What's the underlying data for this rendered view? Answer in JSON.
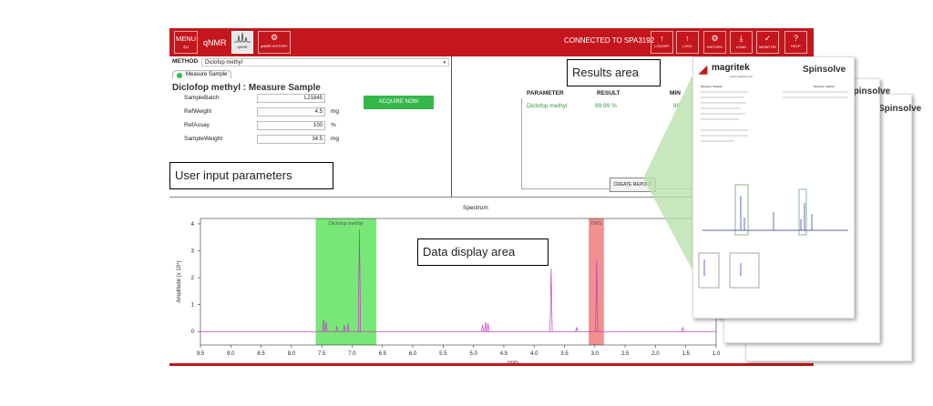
{
  "toolbar": {
    "menu_label": "MENU",
    "qnmr_label": "qNMR",
    "peaks_label": "qNMR",
    "history_label": "qNMR HISTORY",
    "connected_text": "CONNECTED TO SPA3192",
    "buttons": [
      {
        "icon": "up-arrow-icon",
        "glyph": "↑",
        "label": "LOGOFF"
      },
      {
        "icon": "up-arrow-icon",
        "glyph": "↑",
        "label": "LOCK"
      },
      {
        "icon": "gears-icon",
        "glyph": "⚙",
        "label": "HISTORY"
      },
      {
        "icon": "download-icon",
        "glyph": "⤓",
        "label": "LOAD"
      },
      {
        "icon": "checkmark-icon",
        "glyph": "✓",
        "label": "MONITOR"
      },
      {
        "icon": "question-icon",
        "glyph": "?",
        "label": "HELP"
      }
    ]
  },
  "method": {
    "label": "METHOD",
    "value": "Diclofop methyl"
  },
  "tab": {
    "label": "Measure Sample"
  },
  "form": {
    "title": "Diclofop methyl : Measure Sample",
    "fields": [
      {
        "label": "SampleBatch",
        "value": "L21845",
        "unit": ""
      },
      {
        "label": "RefWeight",
        "value": "4.5",
        "unit": "mg"
      },
      {
        "label": "RefAssay",
        "value": "100",
        "unit": "%"
      },
      {
        "label": "SampleWeight",
        "value": "34.5",
        "unit": "mg"
      }
    ],
    "acquire_label": "ACQUIRE NOW"
  },
  "callouts": {
    "user_input": "User input parameters",
    "results": "Results area",
    "data_display": "Data display area"
  },
  "results": {
    "headers": [
      "PARAMETER",
      "RESULT",
      "MIN"
    ],
    "row": {
      "parameter": "Diclofop methyl",
      "result": "99.99 %",
      "min": "99"
    },
    "create_report": "CREATE REPORT"
  },
  "spectrum": {
    "title": "Spectrum",
    "region_labels": [
      "Diclofop methyl",
      "DMS"
    ],
    "colors": {
      "region1": "#5fe35f",
      "region2": "#f07c7c",
      "trace": "#c23cbf"
    }
  },
  "chart_data": {
    "type": "line",
    "xlabel": "ppm",
    "ylabel": "Amplitude (x 10⁴)",
    "xlim": [
      9.5,
      1.0
    ],
    "ylim": [
      -0.5,
      4.2
    ],
    "xticks": [
      "9.5",
      "9.0",
      "8.5",
      "8.0",
      "7.5",
      "7.0",
      "6.5",
      "6.0",
      "5.5",
      "5.0",
      "4.5",
      "4.0",
      "3.5",
      "3.0",
      "2.5",
      "2.0",
      "1.5",
      "1.0"
    ],
    "yticks": [
      "0",
      "1",
      "2",
      "3",
      "4"
    ],
    "regions": [
      {
        "name": "Diclofop methyl",
        "x_from": 7.6,
        "x_to": 6.6
      },
      {
        "name": "DMS",
        "x_from": 3.1,
        "x_to": 2.85
      }
    ],
    "peaks": [
      {
        "x": 7.47,
        "y": 0.45
      },
      {
        "x": 7.43,
        "y": 0.35
      },
      {
        "x": 7.25,
        "y": 0.2
      },
      {
        "x": 7.13,
        "y": 0.25
      },
      {
        "x": 7.07,
        "y": 0.3
      },
      {
        "x": 6.88,
        "y": 3.8
      },
      {
        "x": 4.85,
        "y": 0.25
      },
      {
        "x": 4.8,
        "y": 0.35
      },
      {
        "x": 4.76,
        "y": 0.3
      },
      {
        "x": 3.72,
        "y": 2.35
      },
      {
        "x": 3.3,
        "y": 0.15
      },
      {
        "x": 2.97,
        "y": 2.65
      },
      {
        "x": 1.55,
        "y": 0.15
      }
    ]
  },
  "report": {
    "company": "magritek",
    "website": "www.magritek.com",
    "product": "Spinsolve",
    "title": "Measure Sample",
    "sample_name": "Diclofop methyl"
  }
}
